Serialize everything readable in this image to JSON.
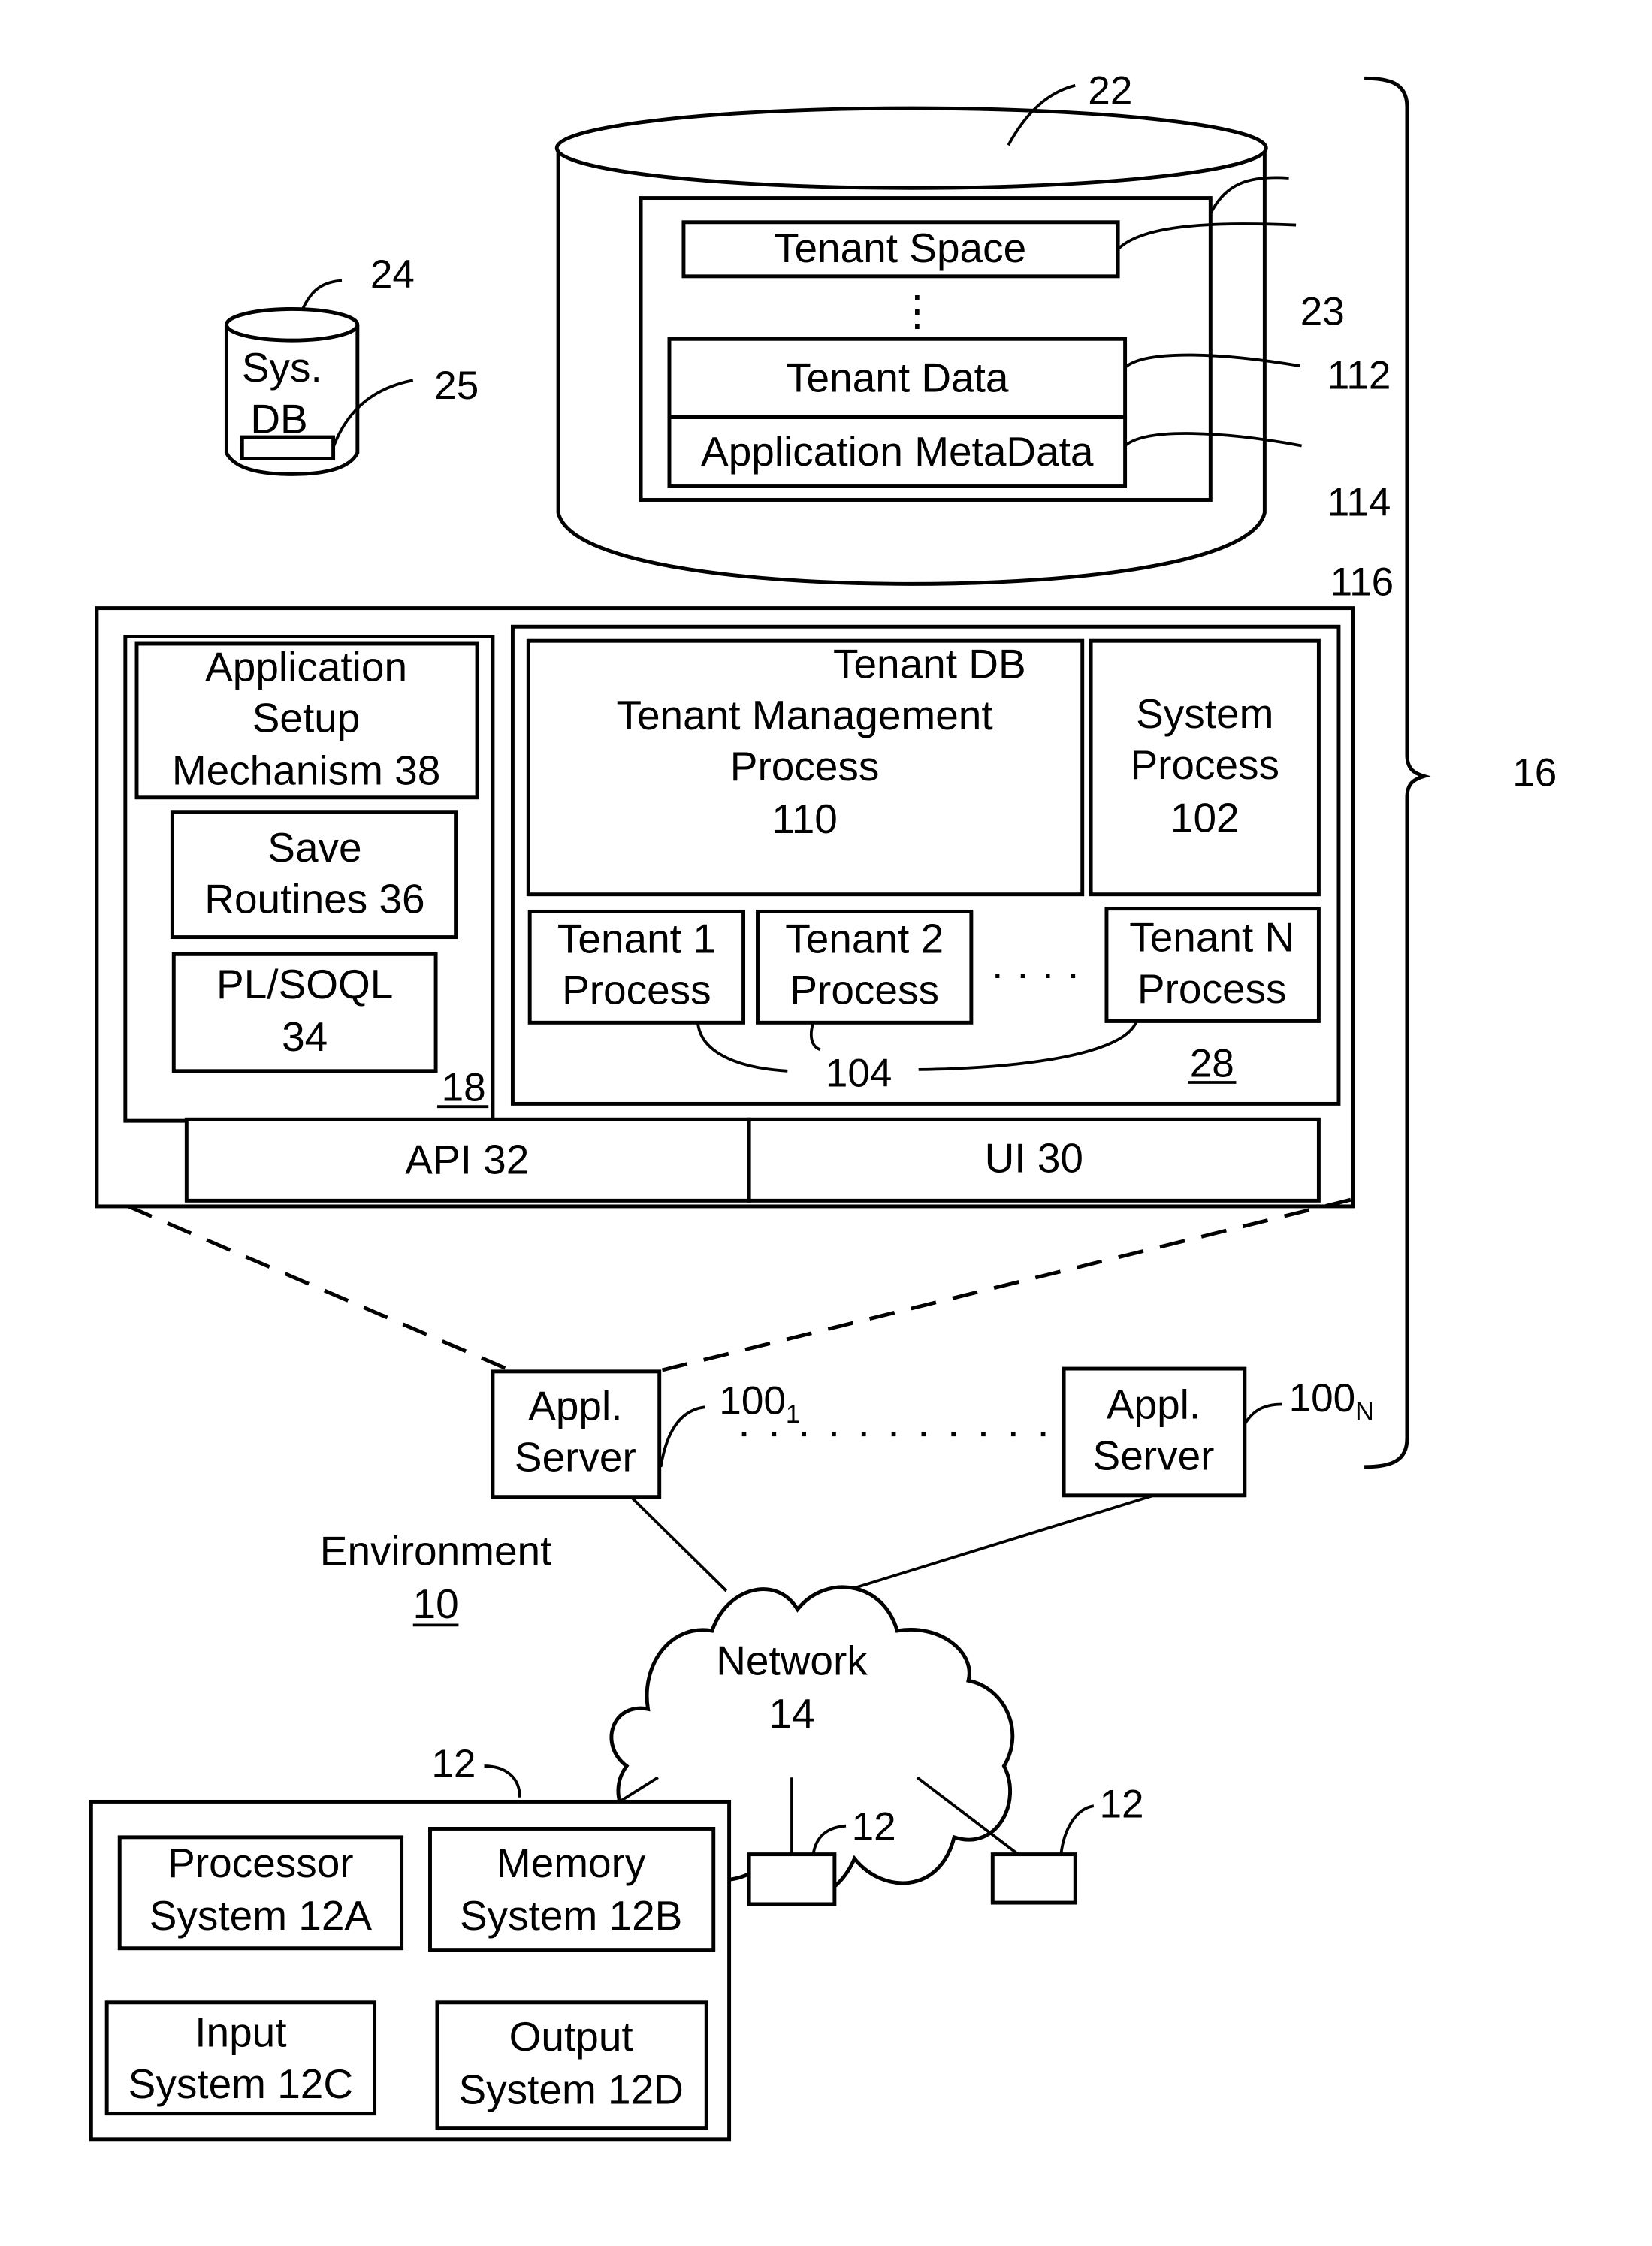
{
  "figure": {
    "environment": {
      "label": "Environment",
      "ref": "10"
    },
    "system": {
      "ref": "16"
    },
    "tenant_db": {
      "ref": "22",
      "storage_ref": "23",
      "tenant_space": "Tenant Space",
      "ellipsis": "⋮",
      "tenant_data": "Tenant Data",
      "app_metadata": "Application MetaData",
      "refs": [
        "112",
        "114",
        "116"
      ]
    },
    "sys_db": {
      "line1": "Sys.",
      "line2": "DB",
      "ref": "24",
      "sub_ref": "25"
    },
    "program_code": {
      "ref": "18",
      "app_setup": [
        "Application",
        "Setup",
        "Mechanism 38"
      ],
      "save_routines": [
        "Save",
        "Routines 36"
      ],
      "plsoql": [
        "PL/SOQL",
        "34"
      ]
    },
    "process_space": {
      "ref": "28",
      "tenant_mgmt": [
        "Tenant DB",
        "Tenant Management",
        "Process",
        "110"
      ],
      "system_process": [
        "System",
        "Process",
        "102"
      ],
      "tenant_processes": [
        {
          "line1": "Tenant 1",
          "line2": "Process"
        },
        {
          "line1": "Tenant 2",
          "line2": "Process"
        },
        {
          "line1": "Tenant N",
          "line2": "Process"
        }
      ],
      "ellipsis": "· · · ·",
      "tenant_process_ref": "104"
    },
    "api": "API 32",
    "ui": "UI 30",
    "app_servers": [
      {
        "line1": "Appl.",
        "line2": "Server",
        "ref": "100",
        "sub": "1"
      },
      {
        "line1": "Appl.",
        "line2": "Server",
        "ref": "100",
        "sub": "N"
      }
    ],
    "network": {
      "line1": "Network",
      "line2": "14"
    },
    "user_system": {
      "ref": "12",
      "components": [
        {
          "line1": "Processor",
          "line2": "System 12A"
        },
        {
          "line1": "Memory",
          "line2": "System 12B"
        },
        {
          "line1": "Input",
          "line2": "System 12C"
        },
        {
          "line1": "Output",
          "line2": "System 12D"
        }
      ],
      "other_refs": [
        "12",
        "12"
      ]
    }
  }
}
